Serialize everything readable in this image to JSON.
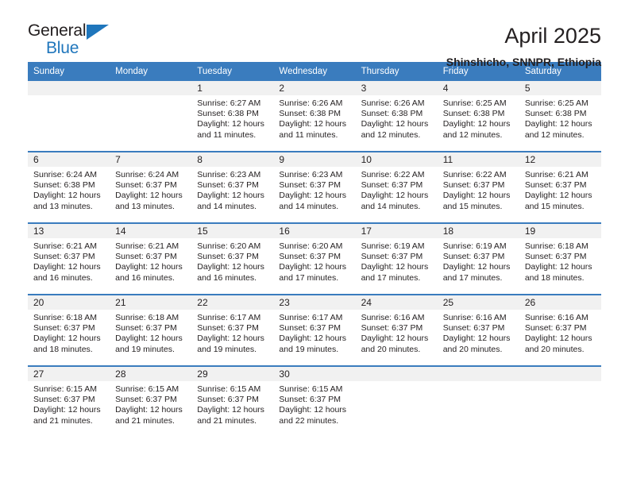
{
  "brand": {
    "name_part1": "General",
    "name_part2": "Blue"
  },
  "header": {
    "title": "April 2025",
    "subtitle": "Shinshicho, SNNPR, Ethiopia"
  },
  "colors": {
    "header_blue": "#3a7cbe",
    "brand_blue": "#1f76bc",
    "daynum_gray": "#f1f1f1",
    "text": "#231f20"
  },
  "weekdays": [
    "Sunday",
    "Monday",
    "Tuesday",
    "Wednesday",
    "Thursday",
    "Friday",
    "Saturday"
  ],
  "weeks": [
    [
      {
        "day": "",
        "sunrise": "",
        "sunset": "",
        "daylight": ""
      },
      {
        "day": "",
        "sunrise": "",
        "sunset": "",
        "daylight": ""
      },
      {
        "day": "1",
        "sunrise": "Sunrise: 6:27 AM",
        "sunset": "Sunset: 6:38 PM",
        "daylight": "Daylight: 12 hours and 11 minutes."
      },
      {
        "day": "2",
        "sunrise": "Sunrise: 6:26 AM",
        "sunset": "Sunset: 6:38 PM",
        "daylight": "Daylight: 12 hours and 11 minutes."
      },
      {
        "day": "3",
        "sunrise": "Sunrise: 6:26 AM",
        "sunset": "Sunset: 6:38 PM",
        "daylight": "Daylight: 12 hours and 12 minutes."
      },
      {
        "day": "4",
        "sunrise": "Sunrise: 6:25 AM",
        "sunset": "Sunset: 6:38 PM",
        "daylight": "Daylight: 12 hours and 12 minutes."
      },
      {
        "day": "5",
        "sunrise": "Sunrise: 6:25 AM",
        "sunset": "Sunset: 6:38 PM",
        "daylight": "Daylight: 12 hours and 12 minutes."
      }
    ],
    [
      {
        "day": "6",
        "sunrise": "Sunrise: 6:24 AM",
        "sunset": "Sunset: 6:38 PM",
        "daylight": "Daylight: 12 hours and 13 minutes."
      },
      {
        "day": "7",
        "sunrise": "Sunrise: 6:24 AM",
        "sunset": "Sunset: 6:37 PM",
        "daylight": "Daylight: 12 hours and 13 minutes."
      },
      {
        "day": "8",
        "sunrise": "Sunrise: 6:23 AM",
        "sunset": "Sunset: 6:37 PM",
        "daylight": "Daylight: 12 hours and 14 minutes."
      },
      {
        "day": "9",
        "sunrise": "Sunrise: 6:23 AM",
        "sunset": "Sunset: 6:37 PM",
        "daylight": "Daylight: 12 hours and 14 minutes."
      },
      {
        "day": "10",
        "sunrise": "Sunrise: 6:22 AM",
        "sunset": "Sunset: 6:37 PM",
        "daylight": "Daylight: 12 hours and 14 minutes."
      },
      {
        "day": "11",
        "sunrise": "Sunrise: 6:22 AM",
        "sunset": "Sunset: 6:37 PM",
        "daylight": "Daylight: 12 hours and 15 minutes."
      },
      {
        "day": "12",
        "sunrise": "Sunrise: 6:21 AM",
        "sunset": "Sunset: 6:37 PM",
        "daylight": "Daylight: 12 hours and 15 minutes."
      }
    ],
    [
      {
        "day": "13",
        "sunrise": "Sunrise: 6:21 AM",
        "sunset": "Sunset: 6:37 PM",
        "daylight": "Daylight: 12 hours and 16 minutes."
      },
      {
        "day": "14",
        "sunrise": "Sunrise: 6:21 AM",
        "sunset": "Sunset: 6:37 PM",
        "daylight": "Daylight: 12 hours and 16 minutes."
      },
      {
        "day": "15",
        "sunrise": "Sunrise: 6:20 AM",
        "sunset": "Sunset: 6:37 PM",
        "daylight": "Daylight: 12 hours and 16 minutes."
      },
      {
        "day": "16",
        "sunrise": "Sunrise: 6:20 AM",
        "sunset": "Sunset: 6:37 PM",
        "daylight": "Daylight: 12 hours and 17 minutes."
      },
      {
        "day": "17",
        "sunrise": "Sunrise: 6:19 AM",
        "sunset": "Sunset: 6:37 PM",
        "daylight": "Daylight: 12 hours and 17 minutes."
      },
      {
        "day": "18",
        "sunrise": "Sunrise: 6:19 AM",
        "sunset": "Sunset: 6:37 PM",
        "daylight": "Daylight: 12 hours and 17 minutes."
      },
      {
        "day": "19",
        "sunrise": "Sunrise: 6:18 AM",
        "sunset": "Sunset: 6:37 PM",
        "daylight": "Daylight: 12 hours and 18 minutes."
      }
    ],
    [
      {
        "day": "20",
        "sunrise": "Sunrise: 6:18 AM",
        "sunset": "Sunset: 6:37 PM",
        "daylight": "Daylight: 12 hours and 18 minutes."
      },
      {
        "day": "21",
        "sunrise": "Sunrise: 6:18 AM",
        "sunset": "Sunset: 6:37 PM",
        "daylight": "Daylight: 12 hours and 19 minutes."
      },
      {
        "day": "22",
        "sunrise": "Sunrise: 6:17 AM",
        "sunset": "Sunset: 6:37 PM",
        "daylight": "Daylight: 12 hours and 19 minutes."
      },
      {
        "day": "23",
        "sunrise": "Sunrise: 6:17 AM",
        "sunset": "Sunset: 6:37 PM",
        "daylight": "Daylight: 12 hours and 19 minutes."
      },
      {
        "day": "24",
        "sunrise": "Sunrise: 6:16 AM",
        "sunset": "Sunset: 6:37 PM",
        "daylight": "Daylight: 12 hours and 20 minutes."
      },
      {
        "day": "25",
        "sunrise": "Sunrise: 6:16 AM",
        "sunset": "Sunset: 6:37 PM",
        "daylight": "Daylight: 12 hours and 20 minutes."
      },
      {
        "day": "26",
        "sunrise": "Sunrise: 6:16 AM",
        "sunset": "Sunset: 6:37 PM",
        "daylight": "Daylight: 12 hours and 20 minutes."
      }
    ],
    [
      {
        "day": "27",
        "sunrise": "Sunrise: 6:15 AM",
        "sunset": "Sunset: 6:37 PM",
        "daylight": "Daylight: 12 hours and 21 minutes."
      },
      {
        "day": "28",
        "sunrise": "Sunrise: 6:15 AM",
        "sunset": "Sunset: 6:37 PM",
        "daylight": "Daylight: 12 hours and 21 minutes."
      },
      {
        "day": "29",
        "sunrise": "Sunrise: 6:15 AM",
        "sunset": "Sunset: 6:37 PM",
        "daylight": "Daylight: 12 hours and 21 minutes."
      },
      {
        "day": "30",
        "sunrise": "Sunrise: 6:15 AM",
        "sunset": "Sunset: 6:37 PM",
        "daylight": "Daylight: 12 hours and 22 minutes."
      },
      {
        "day": "",
        "sunrise": "",
        "sunset": "",
        "daylight": ""
      },
      {
        "day": "",
        "sunrise": "",
        "sunset": "",
        "daylight": ""
      },
      {
        "day": "",
        "sunrise": "",
        "sunset": "",
        "daylight": ""
      }
    ]
  ]
}
